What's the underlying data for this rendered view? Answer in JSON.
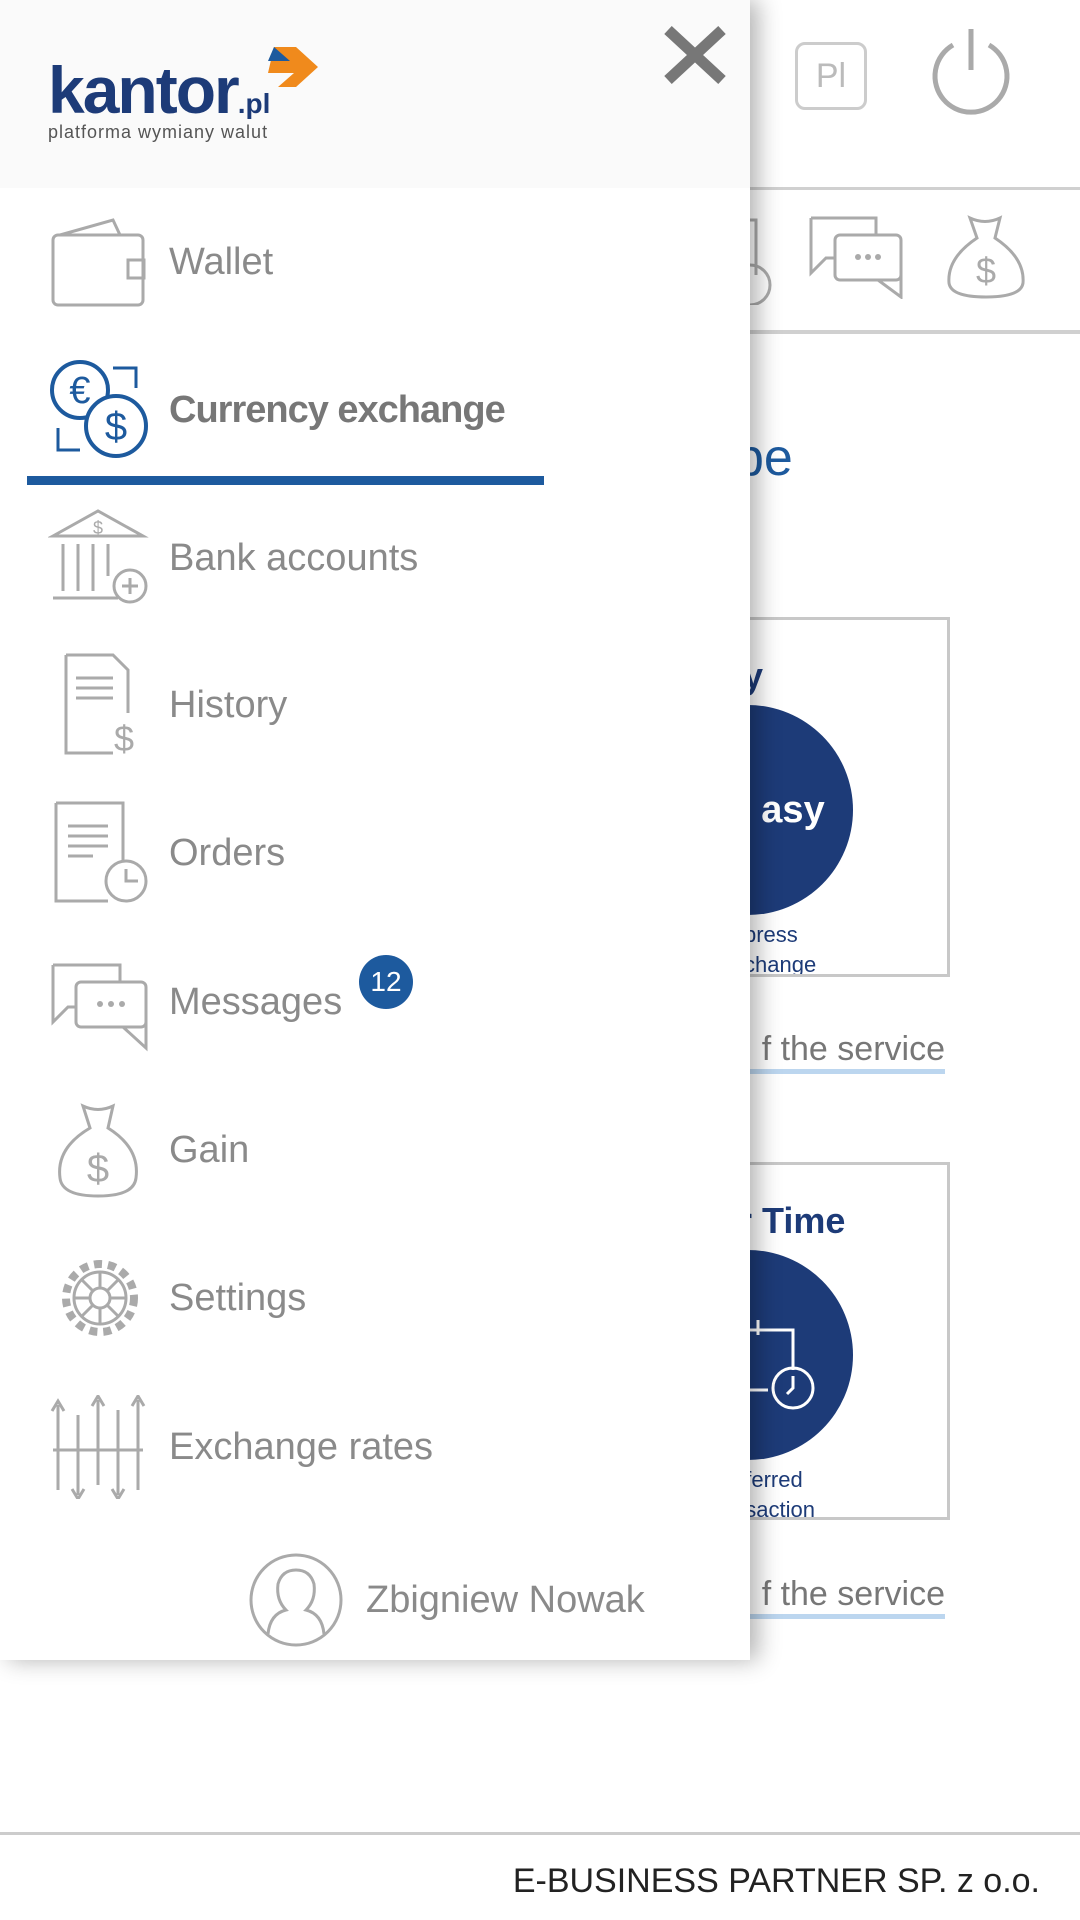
{
  "header": {
    "language": "Pl",
    "power_icon": "power-icon"
  },
  "toolbar_icons": [
    "orders-icon",
    "messages-icon",
    "gain-icon"
  ],
  "main": {
    "title_fragment": "pe",
    "cards": [
      {
        "title": "asy",
        "circle_text": "asy",
        "sub1": "xpress",
        "sub2": "xchange",
        "link": "f the service"
      },
      {
        "title": "r Time",
        "circle_text": "",
        "sub1": "eferred",
        "sub2": "nsaction",
        "link": "f the service"
      }
    ]
  },
  "footer": {
    "company": "E-BUSINESS PARTNER SP. z o.o."
  },
  "drawer": {
    "logo": {
      "brand": "kantor",
      "tld": ".pl",
      "tagline": "platforma wymiany walut"
    },
    "items": [
      {
        "label": "Wallet",
        "icon": "wallet-icon"
      },
      {
        "label": "Currency exchange",
        "icon": "currency-exchange-icon",
        "active": true
      },
      {
        "label": "Bank accounts",
        "icon": "bank-icon"
      },
      {
        "label": "History",
        "icon": "history-icon"
      },
      {
        "label": "Orders",
        "icon": "orders-icon"
      },
      {
        "label": "Messages",
        "icon": "messages-icon",
        "badge": "12"
      },
      {
        "label": "Gain",
        "icon": "money-bag-icon"
      },
      {
        "label": "Settings",
        "icon": "gear-icon"
      },
      {
        "label": "Exchange rates",
        "icon": "exchange-rates-icon"
      }
    ],
    "user": {
      "name": "Zbigniew Nowak"
    },
    "accent": "#1d5a9e"
  }
}
